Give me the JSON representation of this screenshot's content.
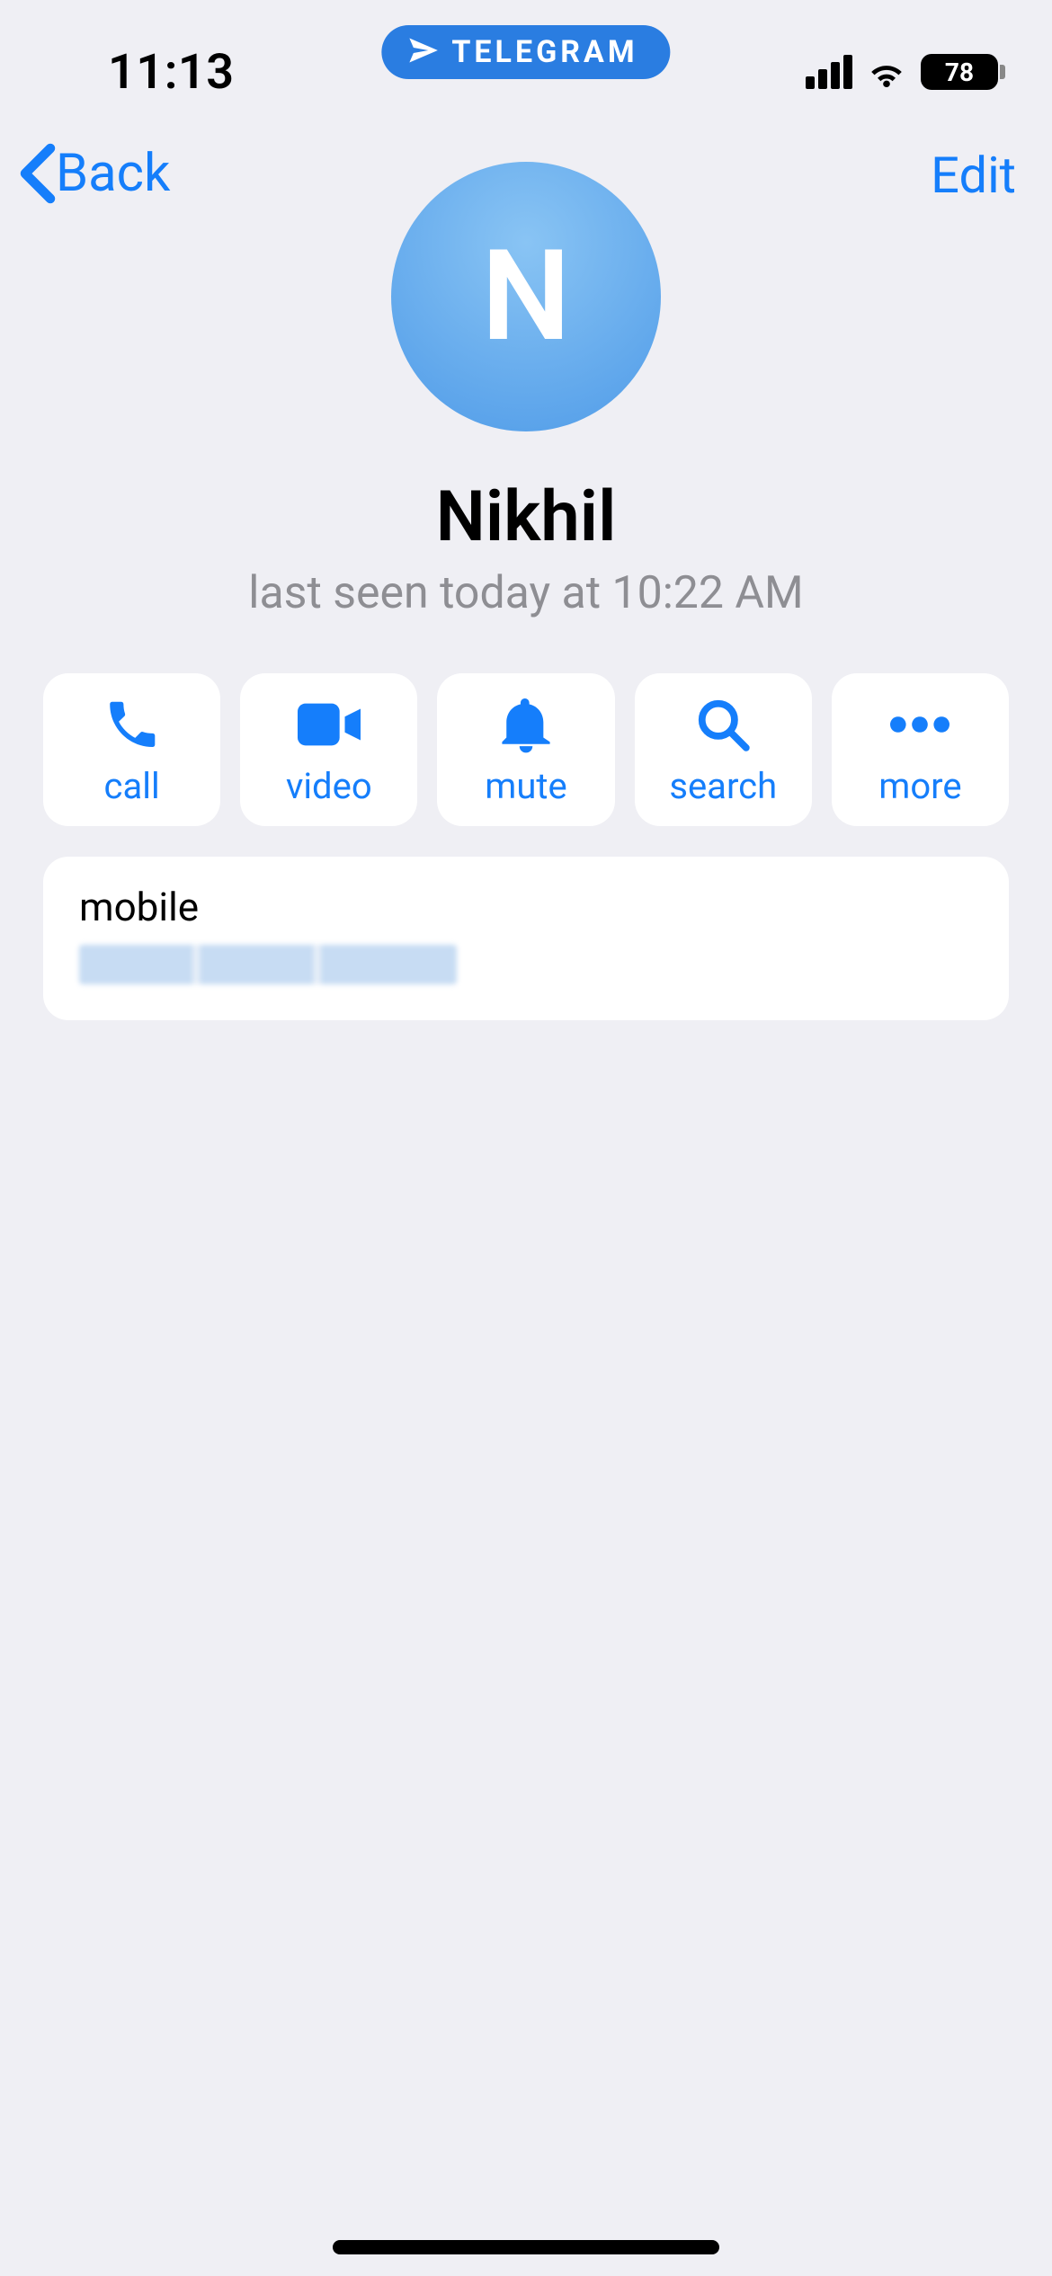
{
  "status": {
    "time": "11:13",
    "battery_pct": "78",
    "app_pill_label": "TELEGRAM"
  },
  "nav": {
    "back_label": "Back",
    "edit_label": "Edit"
  },
  "profile": {
    "avatar_letter": "N",
    "name": "Nikhil",
    "status": "last seen today at 10:22 AM"
  },
  "actions": {
    "call": "call",
    "video": "video",
    "mute": "mute",
    "search": "search",
    "more": "more"
  },
  "info": {
    "mobile_label": "mobile"
  }
}
